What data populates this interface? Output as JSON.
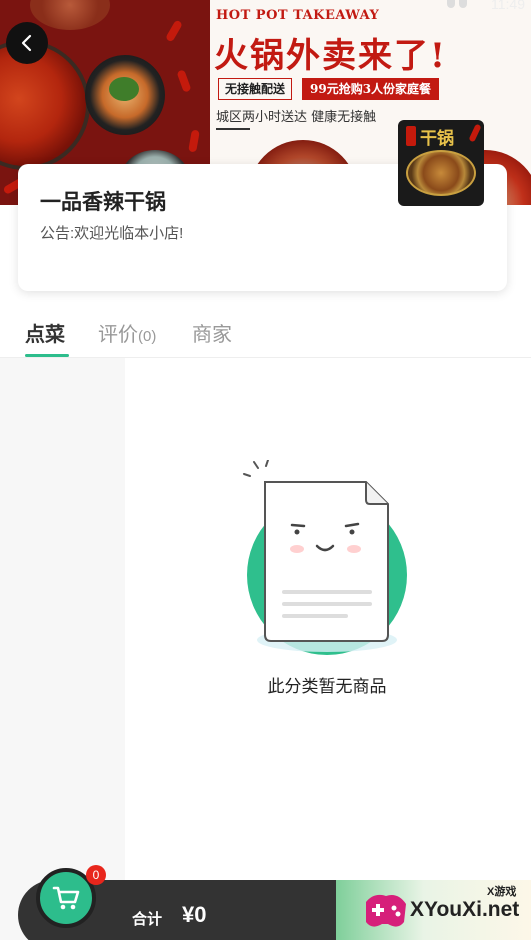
{
  "status_bar": {
    "time": "11:49"
  },
  "banner": {
    "title_en": "HOT POT TAKEAWAY",
    "title_cn": "火锅外卖来了!",
    "tag_contactless": "无接触配送",
    "tag_promo": "99元抢购3人份家庭餐",
    "subtitle": "城区两小时送达 健康无接触"
  },
  "store": {
    "name": "一品香辣干锅",
    "notice": "公告:欢迎光临本小店!",
    "logo_text": "干锅"
  },
  "tabs": [
    {
      "label": "点菜",
      "count": ""
    },
    {
      "label": "评价",
      "count": "(0)"
    },
    {
      "label": "商家",
      "count": ""
    }
  ],
  "empty_state": {
    "message": "此分类暂无商品"
  },
  "cart": {
    "badge_count": "0",
    "total_label": "合计",
    "total_value": "¥0"
  },
  "watermark": {
    "small": "X游戏",
    "text": "XYouXi.net"
  },
  "colors": {
    "accent": "#2dbd8c",
    "banner_red": "#c21a12",
    "cart_bar": "#333333",
    "badge": "#e8261c"
  }
}
